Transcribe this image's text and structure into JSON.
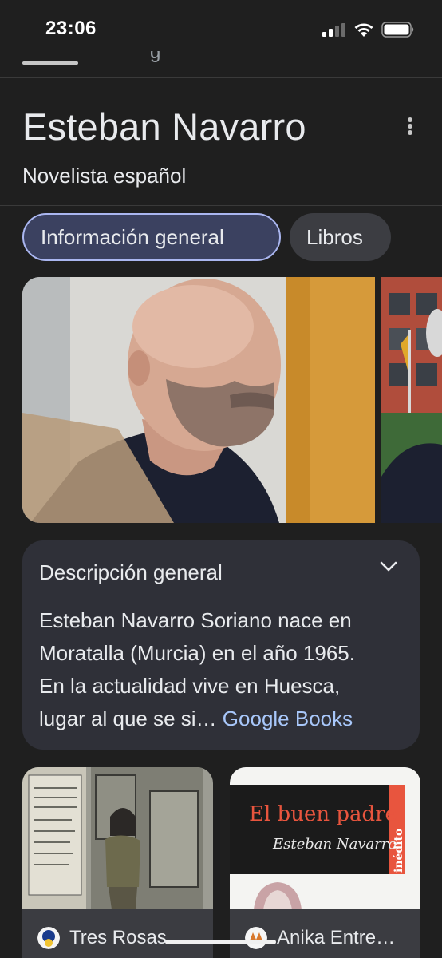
{
  "status_bar": {
    "time": "23:06"
  },
  "entity": {
    "title": "Esteban Navarro",
    "subtitle": "Novelista español"
  },
  "chips": [
    {
      "label": "Información general",
      "selected": true
    },
    {
      "label": "Libros",
      "selected": false
    }
  ],
  "description": {
    "title": "Descripción general",
    "lines": [
      "Esteban Navarro Soriano nace en",
      "Moratalla (Murcia) en el año 1965.",
      "En la actualidad vive en Huesca,",
      "lugar al que se si…"
    ],
    "source": "Google Books"
  },
  "books": [
    {
      "label": "Tres Rosas"
    },
    {
      "label": "Anika Entre…",
      "cover_title": "El buen padre",
      "cover_author": "Esteban Navarro",
      "cover_badge": "inédito"
    }
  ],
  "colors": {
    "background": "#1f1f1f",
    "chip_active_bg": "#3b4160",
    "chip_active_border": "#aab6f0",
    "link": "#a8c7fa",
    "card_bg": "#2f3038"
  },
  "icons": [
    "signal-icon",
    "wifi-icon",
    "battery-icon",
    "more-vert-icon",
    "chevron-down-icon"
  ]
}
